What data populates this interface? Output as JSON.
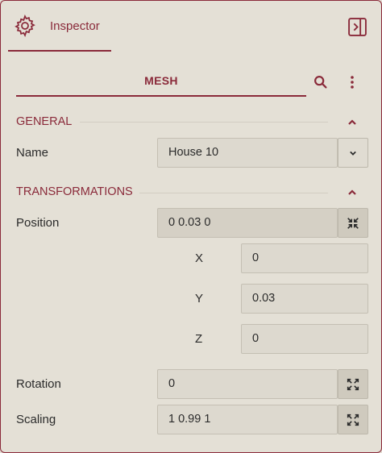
{
  "header": {
    "tab_label": "Inspector",
    "icons": {
      "settings": "gear-icon",
      "sidebar": "sidebar-toggle-icon"
    }
  },
  "mesh_tab": {
    "label": "MESH",
    "search_icon": "search-icon",
    "more_icon": "more-vertical-icon"
  },
  "general": {
    "title": "GENERAL",
    "name_label": "Name",
    "name_value": "House 10"
  },
  "transformations": {
    "title": "TRANSFORMATIONS",
    "position_label": "Position",
    "position_value": "0 0.03 0",
    "x_label": "X",
    "x_value": "0",
    "y_label": "Y",
    "y_value": "0.03",
    "z_label": "Z",
    "z_value": "0",
    "rotation_label": "Rotation",
    "rotation_value": "0",
    "scaling_label": "Scaling",
    "scaling_value": "1 0.99 1"
  },
  "colors": {
    "accent": "#8a2a3a",
    "background": "#e4e0d6"
  }
}
